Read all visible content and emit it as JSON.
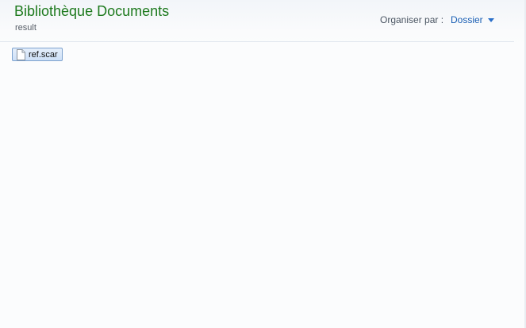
{
  "library": {
    "title": "Bibliothèque Documents",
    "subtitle": "result"
  },
  "arrange": {
    "label": "Organiser par :",
    "value": "Dossier",
    "icon": "chevron-down-icon"
  },
  "files": [
    {
      "name": "ref.scar",
      "icon": "document-icon",
      "selected": true
    }
  ],
  "colors": {
    "title": "#1e7a1e",
    "link": "#1a5fb4",
    "selection_border": "#7da2ce",
    "selection_fill": "#cde0f7"
  }
}
